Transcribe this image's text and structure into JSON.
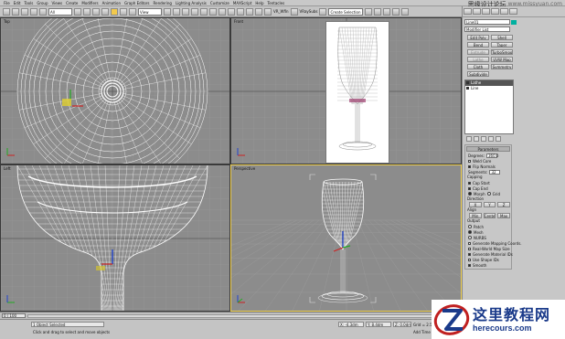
{
  "menu": [
    "File",
    "Edit",
    "Tools",
    "Group",
    "Views",
    "Create",
    "Modifiers",
    "Animation",
    "Graph Editors",
    "Rendering",
    "Lighting Analysis",
    "Customize",
    "MAXScript",
    "Help",
    "Tentacles"
  ],
  "watermark": {
    "cn": "思缘设计论坛",
    "url": "www.missyuan.com"
  },
  "toolbar": {
    "filter": "All",
    "view": "View",
    "renderer": "VR_Wfln",
    "vray": "VRaySubs",
    "selection_set": "Create Selection Set"
  },
  "viewports": {
    "top": {
      "label": "Top"
    },
    "front": {
      "label": "Front"
    },
    "left": {
      "label": "Left"
    },
    "perspective": {
      "label": "Perspective"
    }
  },
  "command_panel": {
    "object_name": "Line01",
    "modifier_list": "Modifier List",
    "buttons": [
      "Edit Poly",
      "Shell",
      "Bend",
      "Taper",
      "Extrude",
      "TurboSmooth",
      "Lathe",
      "UVW Map",
      "Cloth",
      "Symmetry",
      "Subdivide"
    ],
    "disabled_buttons": [
      "Extrude",
      "Lathe"
    ],
    "stack": [
      "Lathe",
      "Line"
    ],
    "stack_selected": 0,
    "params": {
      "header": "Parameters",
      "degrees_label": "Degrees:",
      "degrees": "360.0",
      "weld_core": "Weld Core",
      "flip_normals": "Flip Normals",
      "segments_label": "Segments:",
      "segments": "32",
      "capping": "Capping",
      "cap_start": "Cap Start",
      "cap_end": "Cap End",
      "morph": "Morph",
      "grid": "Grid",
      "direction": "Direction",
      "dir_x": "X",
      "dir_y": "Y",
      "dir_z": "Z",
      "align": "Align",
      "align_min": "Min",
      "align_center": "Center",
      "align_max": "Max",
      "output": "Output",
      "patch": "Patch",
      "mesh": "Mesh",
      "nurbs": "NURBS",
      "gen_mapping": "Generate Mapping Coords.",
      "real_world": "Real-World Map Size",
      "gen_material": "Generate Material IDs",
      "use_shape_ids": "Use Shape IDs",
      "smooth": "Smooth"
    }
  },
  "timeline": {
    "frame": "0 / 100"
  },
  "status": {
    "selection": "1 Object Selected",
    "prompt": "Click and drag to select and move objects",
    "x": "X: -4.3dm",
    "y": "Y: 8.4dm",
    "z": "Z: 0.0dm",
    "grid": "Grid = 2.54dm",
    "add_tag": "Add Time Tag"
  },
  "logo": {
    "cn": "这里教程网",
    "url": "herecours.com"
  }
}
